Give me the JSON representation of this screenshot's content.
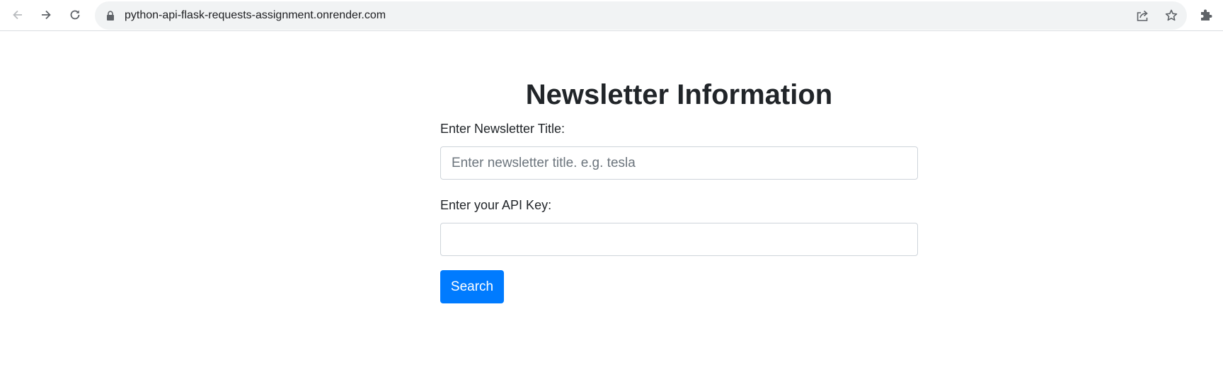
{
  "browser": {
    "url": "python-api-flask-requests-assignment.onrender.com"
  },
  "page": {
    "heading": "Newsletter Information",
    "title_label": "Enter Newsletter Title:",
    "title_placeholder": "Enter newsletter title. e.g. tesla",
    "title_value": "",
    "api_key_label": "Enter your API Key:",
    "api_key_value": "",
    "search_label": "Search"
  },
  "colors": {
    "primary": "#007bff",
    "text": "#212529",
    "omnibox_bg": "#f1f3f4"
  }
}
